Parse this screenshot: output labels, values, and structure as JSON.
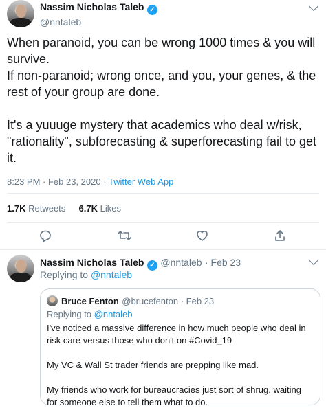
{
  "main_tweet": {
    "author_name": "Nassim Nicholas Taleb",
    "author_handle": "@nntaleb",
    "text": "When paranoid, you can be wrong 1000 times & you will survive.\nIf non-paranoid; wrong once, and you, your genes, & the rest of your group are done.\n\nIt's a yuuuge mystery that academics who deal w/risk, \"rationality\", subforecasting & superforecasting fail to get it.",
    "timestamp": "8:23 PM · Feb 23, 2020 · ",
    "source": "Twitter Web App",
    "retweets_count": "1.7K",
    "retweets_label": "Retweets",
    "likes_count": "6.7K",
    "likes_label": "Likes"
  },
  "actions": {
    "reply_icon": "reply-icon",
    "retweet_icon": "retweet-icon",
    "like_icon": "heart-icon",
    "share_icon": "share-icon"
  },
  "reply_tweet": {
    "author_name": "Nassim Nicholas Taleb",
    "author_handle": "@nntaleb",
    "date": "· Feb 23",
    "replying_prefix": "Replying to ",
    "replying_to": "@nntaleb",
    "quoted": {
      "author_name": "Bruce Fenton",
      "author_handle": "@brucefenton · Feb 23",
      "replying_prefix": "Replying to ",
      "replying_to": "@nntaleb",
      "text": "I've noticed a massive difference in how much people who deal in risk care versus those who don't on #Covid_19\n\nMy VC & Wall St trader friends are prepping like mad.\n\nMy friends who work for bureaucracies just sort of shrug, waiting for someone else to tell them what to do."
    }
  },
  "colors": {
    "verified_blue": "#1da1f2",
    "link_blue": "#1b95e0",
    "muted_gray": "#657786",
    "divider": "#e6ecf0"
  }
}
